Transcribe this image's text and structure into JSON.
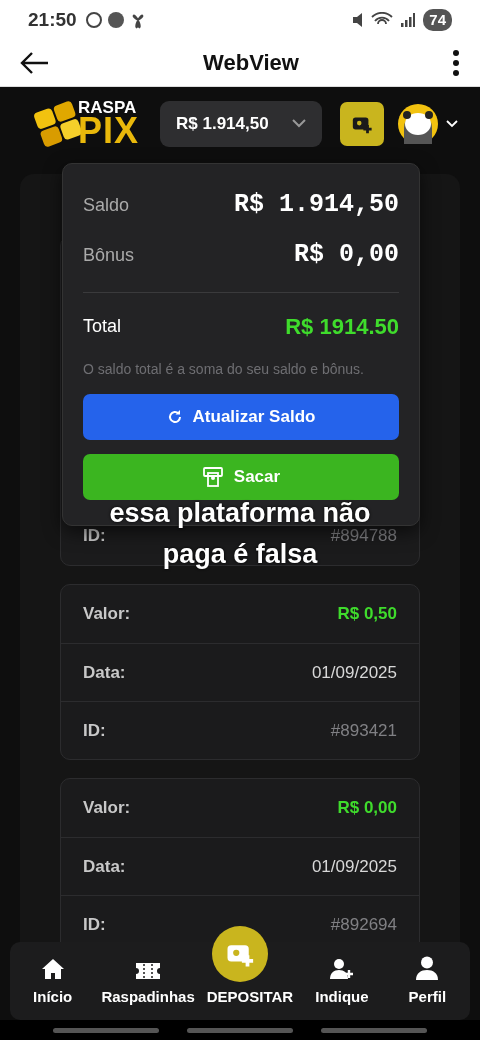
{
  "status_bar": {
    "time": "21:50",
    "battery": "74"
  },
  "app_bar": {
    "title": "WebView"
  },
  "header": {
    "logo_top": "RASPA",
    "logo_bottom": "PIX",
    "balance": "R$ 1.914,50"
  },
  "balance_dropdown": {
    "rows": [
      {
        "label": "Saldo",
        "value": "R$ 1.914,50"
      },
      {
        "label": "Bônus",
        "value": "R$ 0,00"
      }
    ],
    "total": {
      "label": "Total",
      "value": "R$ 1914.50"
    },
    "note": "O saldo total é a soma do seu saldo e bônus.",
    "buttons": [
      {
        "kind": "refresh",
        "label": "Atualizar Saldo"
      },
      {
        "kind": "withdraw",
        "label": "Sacar"
      }
    ]
  },
  "transactions": [
    {
      "fields": [
        {
          "kind": "id",
          "label": "ID:",
          "value": "#894788"
        }
      ]
    },
    {
      "fields": [
        {
          "kind": "amount",
          "label": "Valor:",
          "value": "R$ 0,50"
        },
        {
          "kind": "date",
          "label": "Data:",
          "value": "01/09/2025"
        },
        {
          "kind": "id",
          "label": "ID:",
          "value": "#893421"
        }
      ]
    },
    {
      "fields": [
        {
          "kind": "amount",
          "label": "Valor:",
          "value": "R$ 0,00"
        },
        {
          "kind": "date",
          "label": "Data:",
          "value": "01/09/2025"
        },
        {
          "kind": "id",
          "label": "ID:",
          "value": "#892694"
        }
      ]
    }
  ],
  "caption": {
    "lines": [
      "essa plataforma não",
      "paga é falsa"
    ]
  },
  "bottom_nav": [
    {
      "kind": "home",
      "label": "Início"
    },
    {
      "kind": "tickets",
      "label": "Raspadinhas"
    },
    {
      "kind": "deposit",
      "label": "DEPOSITAR"
    },
    {
      "kind": "invite",
      "label": "Indique"
    },
    {
      "kind": "profile",
      "label": "Perfil"
    }
  ]
}
